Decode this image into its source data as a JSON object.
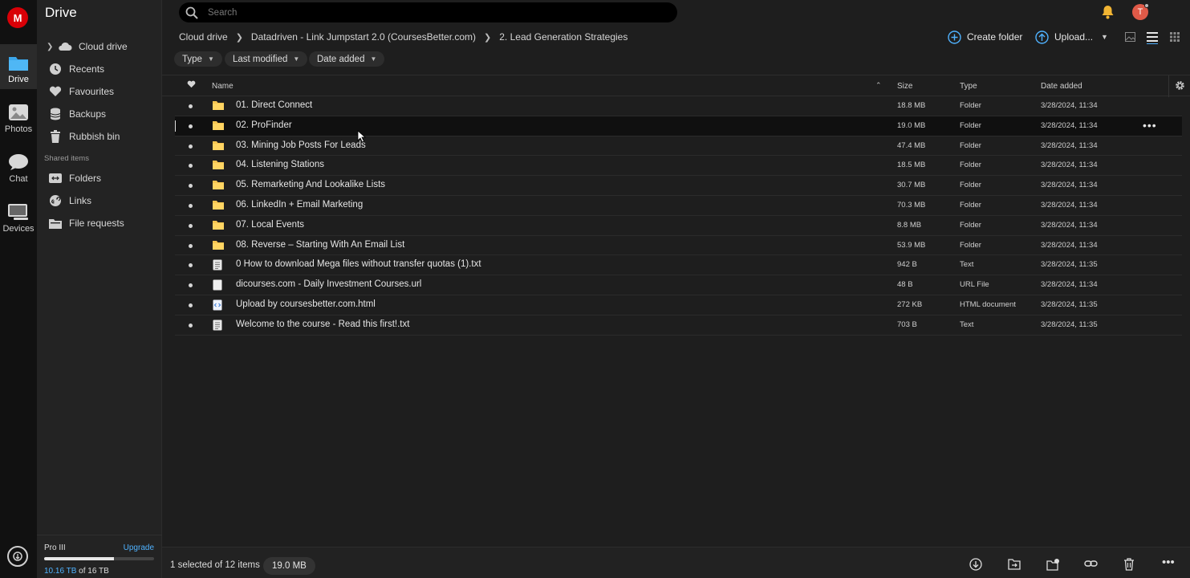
{
  "rail": {
    "logo": "M",
    "items": [
      {
        "label": "Drive"
      },
      {
        "label": "Photos"
      },
      {
        "label": "Chat"
      },
      {
        "label": "Devices"
      }
    ]
  },
  "sidebar": {
    "title": "Drive",
    "items": [
      {
        "label": "Cloud drive"
      },
      {
        "label": "Recents"
      },
      {
        "label": "Favourites"
      },
      {
        "label": "Backups"
      },
      {
        "label": "Rubbish bin"
      }
    ],
    "shared_heading": "Shared items",
    "shared": [
      {
        "label": "Folders"
      },
      {
        "label": "Links"
      },
      {
        "label": "File requests"
      }
    ],
    "storage": {
      "plan": "Pro III",
      "upgrade": "Upgrade",
      "used": "10.16 TB",
      "of_total": " of 16 TB",
      "fraction": 0.635
    }
  },
  "search": {
    "placeholder": "Search"
  },
  "avatar": {
    "initial": "T"
  },
  "breadcrumb": [
    "Cloud drive",
    "Datadriven - Link Jumpstart 2.0 (CoursesBetter.com)",
    "2. Lead Generation Strategies"
  ],
  "actions": {
    "create_folder": "Create folder",
    "upload": "Upload..."
  },
  "filters": [
    "Type",
    "Last modified",
    "Date added"
  ],
  "table": {
    "headers": {
      "name": "Name",
      "size": "Size",
      "type": "Type",
      "date": "Date added"
    },
    "rows": [
      {
        "name": "01. Direct Connect",
        "size": "18.8 MB",
        "type": "Folder",
        "date": "3/28/2024, 11:34",
        "kind": "folder"
      },
      {
        "name": "02. ProFinder",
        "size": "19.0 MB",
        "type": "Folder",
        "date": "3/28/2024, 11:34",
        "kind": "folder",
        "selected": true
      },
      {
        "name": "03. Mining Job Posts For Leads",
        "size": "47.4 MB",
        "type": "Folder",
        "date": "3/28/2024, 11:34",
        "kind": "folder"
      },
      {
        "name": "04. Listening Stations",
        "size": "18.5 MB",
        "type": "Folder",
        "date": "3/28/2024, 11:34",
        "kind": "folder"
      },
      {
        "name": "05. Remarketing And Lookalike Lists",
        "size": "30.7 MB",
        "type": "Folder",
        "date": "3/28/2024, 11:34",
        "kind": "folder"
      },
      {
        "name": "06. LinkedIn + Email Marketing",
        "size": "70.3 MB",
        "type": "Folder",
        "date": "3/28/2024, 11:34",
        "kind": "folder"
      },
      {
        "name": "07. Local Events",
        "size": "8.8 MB",
        "type": "Folder",
        "date": "3/28/2024, 11:34",
        "kind": "folder"
      },
      {
        "name": "08. Reverse – Starting With An Email List",
        "size": "53.9 MB",
        "type": "Folder",
        "date": "3/28/2024, 11:34",
        "kind": "folder"
      },
      {
        "name": "0 How to download Mega files without transfer quotas (1).txt",
        "size": "942 B",
        "type": "Text",
        "date": "3/28/2024, 11:35",
        "kind": "text"
      },
      {
        "name": "dicourses.com - Daily Investment Courses.url",
        "size": "48 B",
        "type": "URL File",
        "date": "3/28/2024, 11:34",
        "kind": "url"
      },
      {
        "name": "Upload by coursesbetter.com.html",
        "size": "272 KB",
        "type": "HTML document",
        "date": "3/28/2024, 11:35",
        "kind": "html"
      },
      {
        "name": "Welcome to the course - Read this first!.txt",
        "size": "703 B",
        "type": "Text",
        "date": "3/28/2024, 11:35",
        "kind": "text"
      }
    ]
  },
  "footer": {
    "selection": "1 selected of 12 items",
    "selected_size": "19.0 MB"
  }
}
